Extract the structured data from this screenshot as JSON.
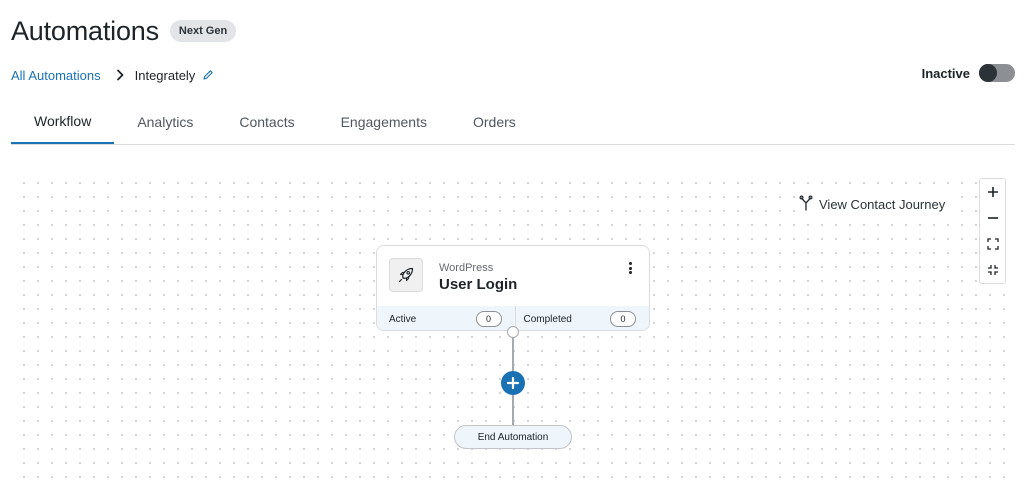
{
  "header": {
    "title": "Automations",
    "badge": "Next Gen"
  },
  "breadcrumb": {
    "root": "All Automations",
    "current": "Integrately"
  },
  "status": {
    "label": "Inactive",
    "enabled": false
  },
  "tabs": [
    {
      "label": "Workflow",
      "active": true
    },
    {
      "label": "Analytics",
      "active": false
    },
    {
      "label": "Contacts",
      "active": false
    },
    {
      "label": "Engagements",
      "active": false
    },
    {
      "label": "Orders",
      "active": false
    }
  ],
  "canvas": {
    "journey_label": "View Contact Journey",
    "zoom_controls": [
      "zoom-in-icon",
      "zoom-out-icon",
      "fit-view-icon",
      "shrink-view-icon"
    ]
  },
  "trigger_node": {
    "icon": "rocket-icon",
    "category": "WordPress",
    "title": "User Login",
    "stats": [
      {
        "label": "Active",
        "count": "0"
      },
      {
        "label": "Completed",
        "count": "0"
      }
    ]
  },
  "end_node": {
    "label": "End Automation"
  },
  "colors": {
    "accent": "#1a72b5",
    "stats_bg": "#eef5fb",
    "badge_bg": "#e2e4e7",
    "toggle_off": "#8c8f94"
  }
}
